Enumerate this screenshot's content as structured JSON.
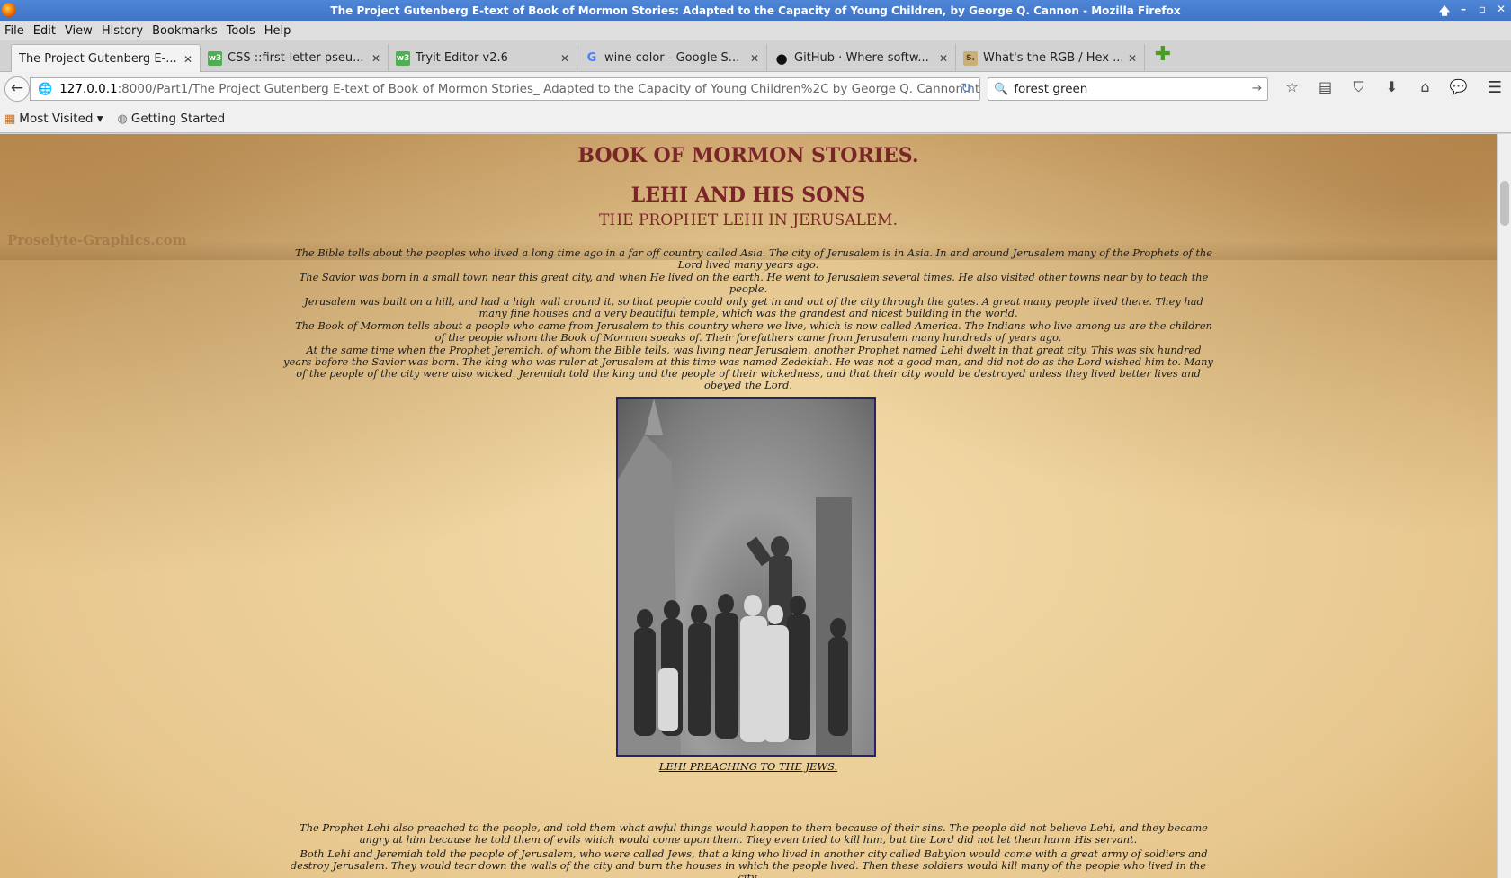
{
  "window": {
    "title": "The Project Gutenberg E-text of Book of Mormon Stories: Adapted to the Capacity of Young Children, by George Q. Cannon - Mozilla Firefox",
    "controls": [
      "🡅",
      "–",
      "▫",
      "✕"
    ]
  },
  "menu": [
    "File",
    "Edit",
    "View",
    "History",
    "Bookmarks",
    "Tools",
    "Help"
  ],
  "tabs": [
    {
      "label": "The Project Gutenberg E-...",
      "icon": "page-icon",
      "glyph": ""
    },
    {
      "label": "CSS ::first-letter pseu...",
      "icon": "w3schools-icon",
      "glyph": "w3"
    },
    {
      "label": "Tryit Editor v2.6",
      "icon": "w3schools-icon",
      "glyph": "w3"
    },
    {
      "label": "wine color - Google S...",
      "icon": "google-icon",
      "glyph": "G"
    },
    {
      "label": "GitHub · Where softw...",
      "icon": "github-icon",
      "glyph": "●"
    },
    {
      "label": "What's the RGB / Hex ...",
      "icon": "stackexchange-icon",
      "glyph": "S."
    }
  ],
  "address": {
    "host": "127.0.0.1",
    "rest": ":8000/Part1/The Project Gutenberg E-text of Book of Mormon Stories_ Adapted to the Capacity of Young Children%2C by George Q. Cannon.htm"
  },
  "search": {
    "value": "forest green"
  },
  "bookmarks": [
    {
      "label": "Most Visited ▾",
      "icon": "most-visited-icon"
    },
    {
      "label": "Getting Started",
      "icon": "globe-icon"
    }
  ],
  "page": {
    "watermark": "Proselyte-Graphics.com",
    "title": "BOOK OF MORMON STORIES.",
    "chapter": "LEHI AND HIS SONS",
    "section": "THE PROPHET LEHI IN JERUSALEM.",
    "paragraphs": [
      "The Bible tells about the peoples who lived a long time ago in a far off country called Asia. The city of Jerusalem is in Asia. In and around Jerusalem many of the Prophets of the Lord lived many years ago.",
      "The Savior was born in a small town near this great city, and when He lived on the earth. He went to Jerusalem several times. He also visited other towns near by to teach the people.",
      "Jerusalem was built on a hill, and had a high wall around it, so that people could only get in and out of the city through the gates. A great many people lived there. They had many fine houses and a very beautiful temple, which was the grandest and nicest building in the world.",
      "The Book of Mormon tells about a people who came from Jerusalem to this country where we live, which is now called America. The Indians who live among us are the children of the people whom the Book of Mormon speaks of. Their forefathers came from Jerusalem many hundreds of years ago.",
      "At the same time when the Prophet Jeremiah, of whom the Bible tells, was living near Jerusalem, another Prophet named Lehi dwelt in that great city. This was six hundred years before the Savior was born. The king who was ruler at Jerusalem at this time was named Zedekiah. He was not a good man, and did not do as the Lord wished him to. Many of the people of the city were also wicked. Jeremiah told the king and the people of their wickedness, and that their city would be destroyed unless they lived better lives and obeyed the Lord."
    ],
    "caption": "LEHI PREACHING TO THE JEWS.",
    "paragraphs2": [
      "The Prophet Lehi also preached to the people, and told them what awful things would happen to them because of their sins. The people did not believe Lehi, and they became angry at him because he told them of evils which would come upon them. They even tried to kill him, but the Lord did not let them harm His servant.",
      "Both Lehi and Jeremiah told the people of Jerusalem, who were called Jews, that a king who lived in another city called Babylon would come with a great army of soldiers and destroy Jerusalem. They would tear down the walls of the city and burn the houses in which the people lived. Then these soldiers would kill many of the people who lived in the city."
    ]
  }
}
